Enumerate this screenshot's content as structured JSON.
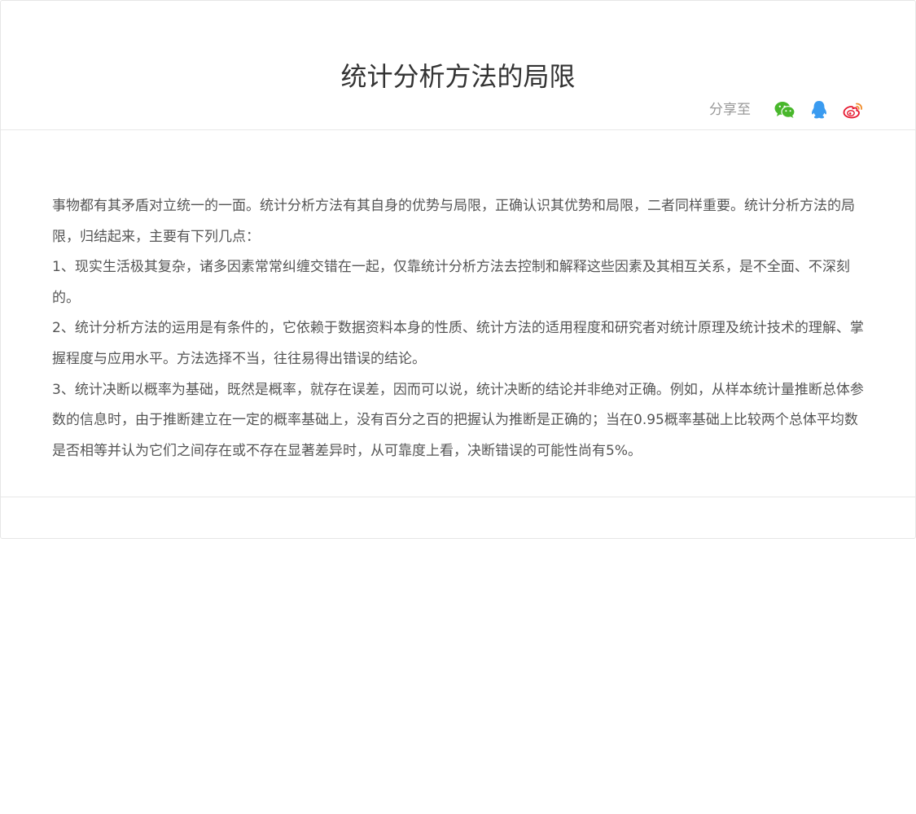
{
  "article": {
    "title": "统计分析方法的局限",
    "share_label": "分享至",
    "share_icons": [
      "wechat-icon",
      "qq-icon",
      "weibo-icon"
    ],
    "paragraphs": [
      "事物都有其矛盾对立统一的一面。统计分析方法有其自身的优势与局限，正确认识其优势和局限，二者同样重要。统计分析方法的局限，归结起来，主要有下列几点：",
      "1、现实生活极其复杂，诸多因素常常纠缠交错在一起，仅靠统计分析方法去控制和解释这些因素及其相互关系，是不全面、不深刻的。",
      "2、统计分析方法的运用是有条件的，它依赖于数据资料本身的性质、统计方法的适用程度和研究者对统计原理及统计技术的理解、掌握程度与应用水平。方法选择不当，往往易得出错误的结论。",
      "3、统计决断以概率为基础，既然是概率，就存在误差，因而可以说，统计决断的结论并非绝对正确。例如，从样本统计量推断总体参数的信息时，由于推断建立在一定的概率基础上，没有百分之百的把握认为推断是正确的；当在0.95概率基础上比较两个总体平均数是否相等并认为它们之间存在或不存在显著差异时，从可靠度上看，决断错误的可能性尚有5%。"
    ]
  },
  "colors": {
    "title": "#333333",
    "body_text": "#555555",
    "muted": "#999999",
    "border": "#e6e6e6",
    "wechat": "#48b72b",
    "qq": "#3a9bf0",
    "weibo": "#e6162d"
  }
}
